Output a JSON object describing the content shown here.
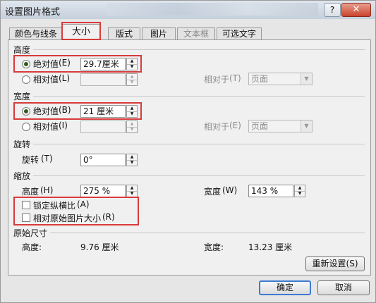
{
  "window": {
    "title": "设置图片格式",
    "help_glyph": "?",
    "close_glyph": "✕"
  },
  "tabs": [
    "颜色与线条",
    "大小",
    "版式",
    "图片",
    "文本框",
    "可选文字"
  ],
  "height": {
    "section": "高度",
    "absolute_label": "绝对值",
    "absolute_key": "(E)",
    "absolute_value": "29.7厘米",
    "relative_label": "相对值",
    "relative_key": "(L)",
    "relative_to_label": "相对于",
    "relative_to_key": "(T)",
    "relative_to_value": "页面"
  },
  "width": {
    "section": "宽度",
    "absolute_label": "绝对值",
    "absolute_key": "(B)",
    "absolute_value": "21 厘米",
    "relative_label": "相对值",
    "relative_key": "(I)",
    "relative_to_label": "相对于",
    "relative_to_key": "(E)",
    "relative_to_value": "页面"
  },
  "rotation": {
    "section": "旋转",
    "label": "旋转",
    "key": "(T)",
    "value": "0°"
  },
  "scale": {
    "section": "缩放",
    "height_label": "高度",
    "height_key": "(H)",
    "height_value": "275 %",
    "width_label": "宽度",
    "width_key": "(W)",
    "width_value": "143 %",
    "lock_label": "锁定纵横比",
    "lock_key": "(A)",
    "relative_label": "相对原始图片大小",
    "relative_key": "(R)"
  },
  "original": {
    "section": "原始尺寸",
    "height_label": "高度:",
    "height_value": "9.76 厘米",
    "width_label": "宽度:",
    "width_value": "13.23 厘米",
    "reset_label": "重新设置",
    "reset_key": "(S)"
  },
  "footer": {
    "ok": "确定",
    "cancel": "取消"
  },
  "colors": {
    "highlight": "#d83b3b",
    "default_button": "#3d7bd1"
  }
}
